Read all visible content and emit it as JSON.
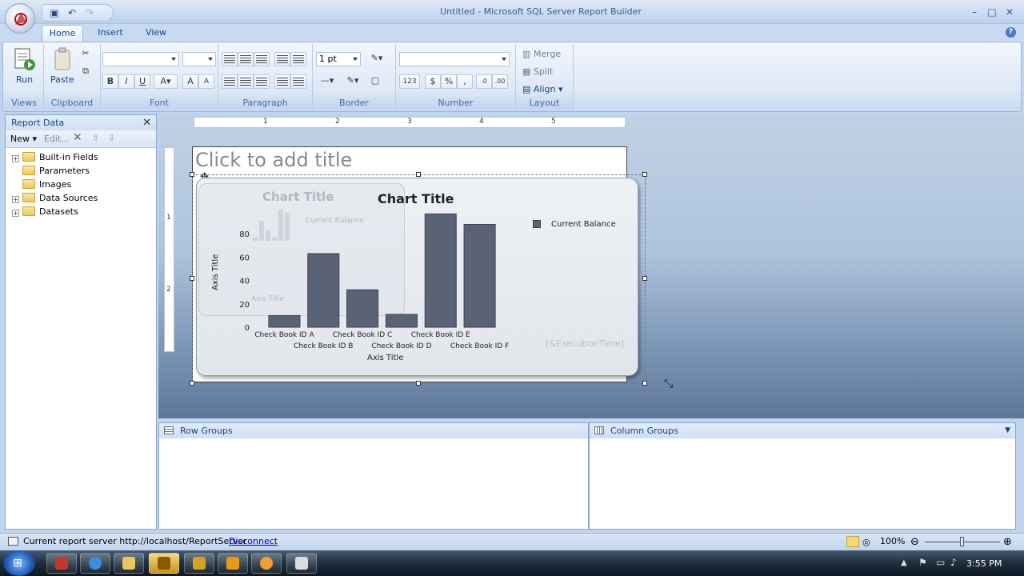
{
  "window": {
    "title": "Untitled - Microsoft SQL Server Report Builder"
  },
  "tabs": [
    {
      "label": "Home"
    },
    {
      "label": "Insert"
    },
    {
      "label": "View"
    }
  ],
  "ribbon": {
    "run_label": "Run",
    "paste_label": "Paste",
    "border_width": "1 pt",
    "merge_label": "Merge",
    "split_label": "Split",
    "align_label": "Align",
    "groups": {
      "views": "Views",
      "clipboard": "Clipboard",
      "font": "Font",
      "paragraph": "Paragraph",
      "border": "Border",
      "number": "Number",
      "layout": "Layout"
    }
  },
  "report_data": {
    "title": "Report Data",
    "new_label": "New",
    "edit_label": "Edit...",
    "items": [
      {
        "label": "Built-in Fields",
        "expandable": true
      },
      {
        "label": "Parameters",
        "expandable": false
      },
      {
        "label": "Images",
        "expandable": false
      },
      {
        "label": "Data Sources",
        "expandable": true
      },
      {
        "label": "Datasets",
        "expandable": true
      }
    ]
  },
  "ruler": {
    "h_marks": [
      "1",
      "2",
      "3",
      "4",
      "5"
    ],
    "v_marks": [
      "1",
      "2"
    ]
  },
  "report": {
    "title_placeholder": "Click to add title",
    "execution_time": "[&ExecutionTime]"
  },
  "chart_data": {
    "type": "bar",
    "title": "Chart Title",
    "xlabel": "Axis Title",
    "ylabel": "Axis Title",
    "categories": [
      "Check Book ID A",
      "Check Book ID B",
      "Check Book ID C",
      "Check Book ID D",
      "Check Book ID E",
      "Check Book ID F"
    ],
    "series": [
      {
        "name": "Current Balance",
        "values": [
          10,
          63,
          32,
          11,
          97,
          88
        ]
      }
    ],
    "yticks": [
      "0",
      "20",
      "40",
      "60",
      "80"
    ],
    "ylim": [
      0,
      100
    ],
    "legend": "top-right",
    "bar_color": "#5a6275"
  },
  "groups": {
    "row_label": "Row Groups",
    "column_label": "Column Groups"
  },
  "status": {
    "server_text": "Current report server http://localhost/ReportServer",
    "disconnect_label": "Disconnect",
    "zoom": "100%"
  },
  "taskbar": {
    "clock": "3:55 PM"
  }
}
